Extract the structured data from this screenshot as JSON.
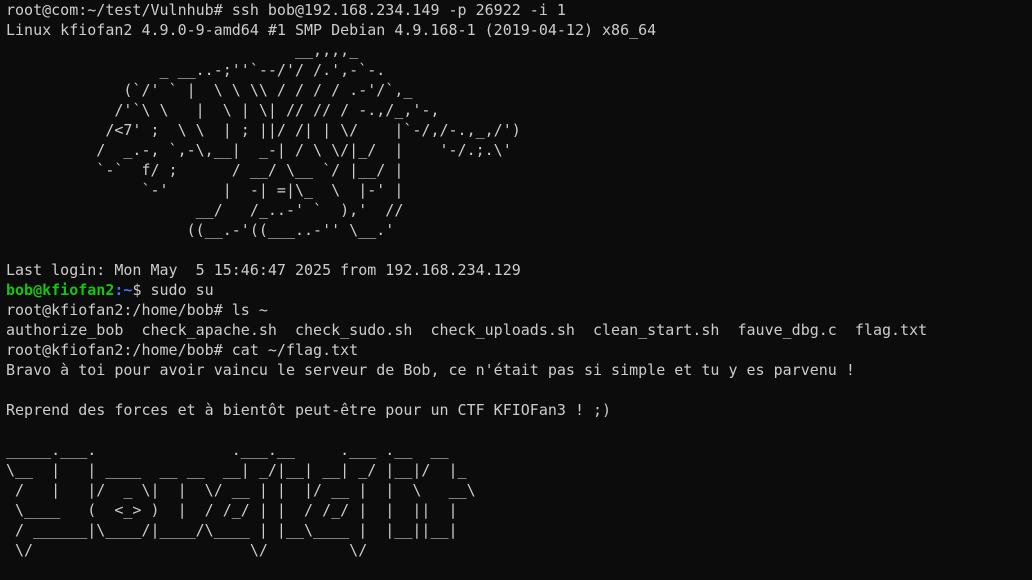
{
  "terminal": {
    "line_ssh": "root@com:~/test/Vulnhub# ssh bob@192.168.234.149 -p 26922 -i 1",
    "line_uname": "Linux kfiofan2 4.9.0-9-amd64 #1 SMP Debian 4.9.168-1 (2019-04-12) x86_64",
    "banner_art": "                                __,,,,_\n                 _ __..-;''`--/'/ /.',-`-.\n             (`/' ` |  \\ \\ \\\\ / / / / .-'/`,_\n            /'`\\ \\   |  \\ | \\| // // / -.,/_,'-,\n           /<7' ;  \\ \\  | ; ||/ /| | \\/    |`-/,/-.,_,/')\n          /  _.-, `,-\\,__|  _-| / \\ \\/|_/  |    '-/.;.\\'\n          `-`  f/ ;      / __/ \\__ `/ |__/ |\n               `-'      |  -| =|\\_  \\  |-' |\n                     __/   /_..-' `  ),'  //\n                    ((__.-'((___..-'' \\__.'",
    "line_lastlogin": "Last login: Mon May  5 15:46:47 2025 from 192.168.234.129",
    "prompt_bob_user": "bob@kfiofan2",
    "prompt_bob_path": ":~",
    "prompt_bob_symbol": "$",
    "cmd_sudo": " sudo su",
    "line_ls": "root@kfiofan2:/home/bob# ls ~",
    "line_files": "authorize_bob  check_apache.sh  check_sudo.sh  check_uploads.sh  clean_start.sh  fauve_dbg.c  flag.txt",
    "line_cat": "root@kfiofan2:/home/bob# cat ~/flag.txt",
    "line_flag1": "Bravo à toi pour avoir vaincu le serveur de Bob, ce n'était pas si simple et tu y es parvenu !",
    "line_flag2": "Reprend des forces et à bientôt peut-être pour un CTF KFIOFan3 ! ;)",
    "footer_art": "_____.___.               .___.__     .___ .__  __\n\\__  |   | ____  __ __  __| _/|__| __| _/ |__|/  |_\n /   |   |/  _ \\|  |  \\/ __ | |  |/ __ |  |  \\   __\\\n \\____   (  <_> )  |  / /_/ | |  / /_/ |  |  ||  |\n / ______|\\____/|____/\\____ | |__\\____ |  |__||__|\n \\/                        \\/         \\/"
  },
  "colors": {
    "background": "#0c0c0c",
    "foreground": "#cccccc",
    "prompt_user": "#16c60c",
    "prompt_path": "#3b78ff"
  }
}
